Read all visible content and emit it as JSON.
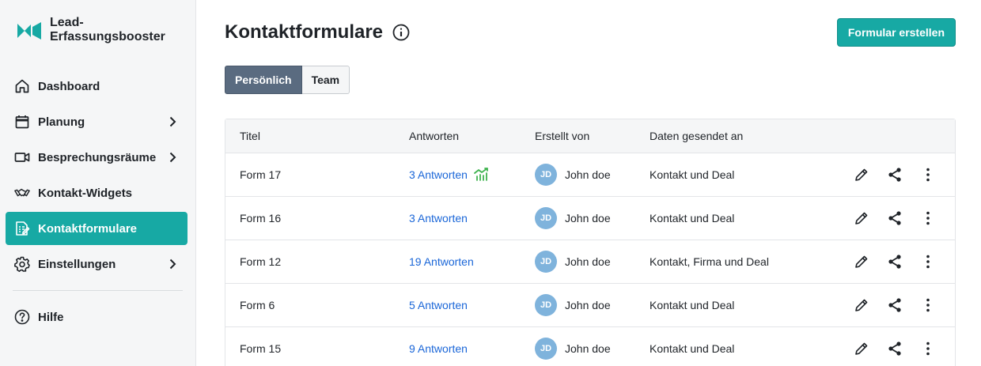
{
  "brand": {
    "line1": "Lead-",
    "line2": "Erfassungsbooster"
  },
  "colors": {
    "accent": "#17a9a4",
    "link": "#1a66d8",
    "avatar": "#7fb3dc",
    "trend": "#3fb34f"
  },
  "sidebar": {
    "items": [
      {
        "label": "Dashboard",
        "icon": "home-icon"
      },
      {
        "label": "Planung",
        "icon": "calendar-icon"
      },
      {
        "label": "Besprechungsräume",
        "icon": "video-icon"
      },
      {
        "label": "Kontakt-Widgets",
        "icon": "handshake-icon"
      },
      {
        "label": "Kontaktformulare",
        "icon": "form-icon"
      },
      {
        "label": "Einstellungen",
        "icon": "gear-icon"
      }
    ],
    "help": {
      "label": "Hilfe",
      "icon": "help-icon"
    }
  },
  "header": {
    "title": "Kontaktformulare",
    "create_label": "Formular erstellen"
  },
  "tabs": {
    "personal": "Persönlich",
    "team": "Team"
  },
  "table": {
    "columns": {
      "title": "Titel",
      "answers": "Antworten",
      "created_by": "Erstellt von",
      "sent_to": "Daten gesendet an"
    },
    "rows": [
      {
        "title": "Form 17",
        "answers": "3 Antworten",
        "initials": "JD",
        "author": "John doe",
        "sent_to": "Kontakt und Deal"
      },
      {
        "title": "Form 16",
        "answers": "3 Antworten",
        "initials": "JD",
        "author": "John doe",
        "sent_to": "Kontakt und Deal"
      },
      {
        "title": "Form 12",
        "answers": "19 Antworten",
        "initials": "JD",
        "author": "John doe",
        "sent_to": "Kontakt, Firma und Deal"
      },
      {
        "title": "Form 6",
        "answers": "5 Antworten",
        "initials": "JD",
        "author": "John doe",
        "sent_to": "Kontakt und Deal"
      },
      {
        "title": "Form 15",
        "answers": "9 Antworten",
        "initials": "JD",
        "author": "John doe",
        "sent_to": "Kontakt und Deal"
      }
    ]
  }
}
